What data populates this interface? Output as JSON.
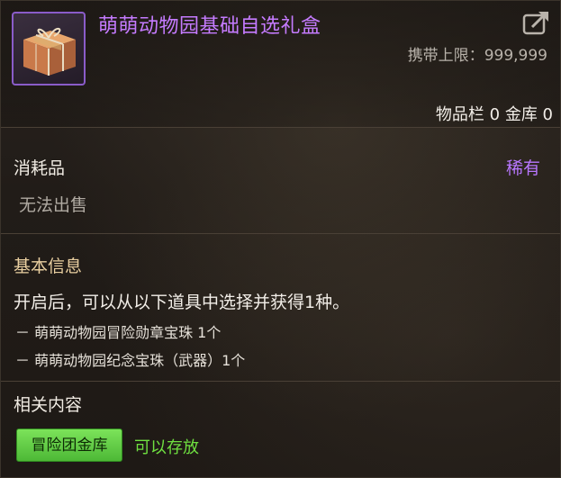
{
  "item": {
    "name": "萌萌动物园基础自选礼盒",
    "icon": "gift-box-icon",
    "carry_limit_label": "携带上限：",
    "carry_limit_value": "999,999",
    "inventory_counts": "物品栏 0 金库 0",
    "type": "消耗品",
    "rarity": "稀有",
    "sell_status": "无法出售"
  },
  "basic_info": {
    "title": "基本信息",
    "description": "开启后，可以从以下道具中选择并获得1种。",
    "options": [
      "－ 萌萌动物园冒险勋章宝珠 1个",
      "－ 萌萌动物园纪念宝珠（武器）1个"
    ]
  },
  "related": {
    "title": "相关内容",
    "tag_button": "冒险团金库",
    "tag_status": "可以存放"
  },
  "colors": {
    "item_name": "#c57bff",
    "rarity": "#b877ff",
    "section_title": "#e9cfa0",
    "tag_button_bg": "#5ccc40",
    "store_ok": "#6fe040"
  },
  "icons": {
    "share": "share-export-icon",
    "item": "gift-box-icon"
  }
}
